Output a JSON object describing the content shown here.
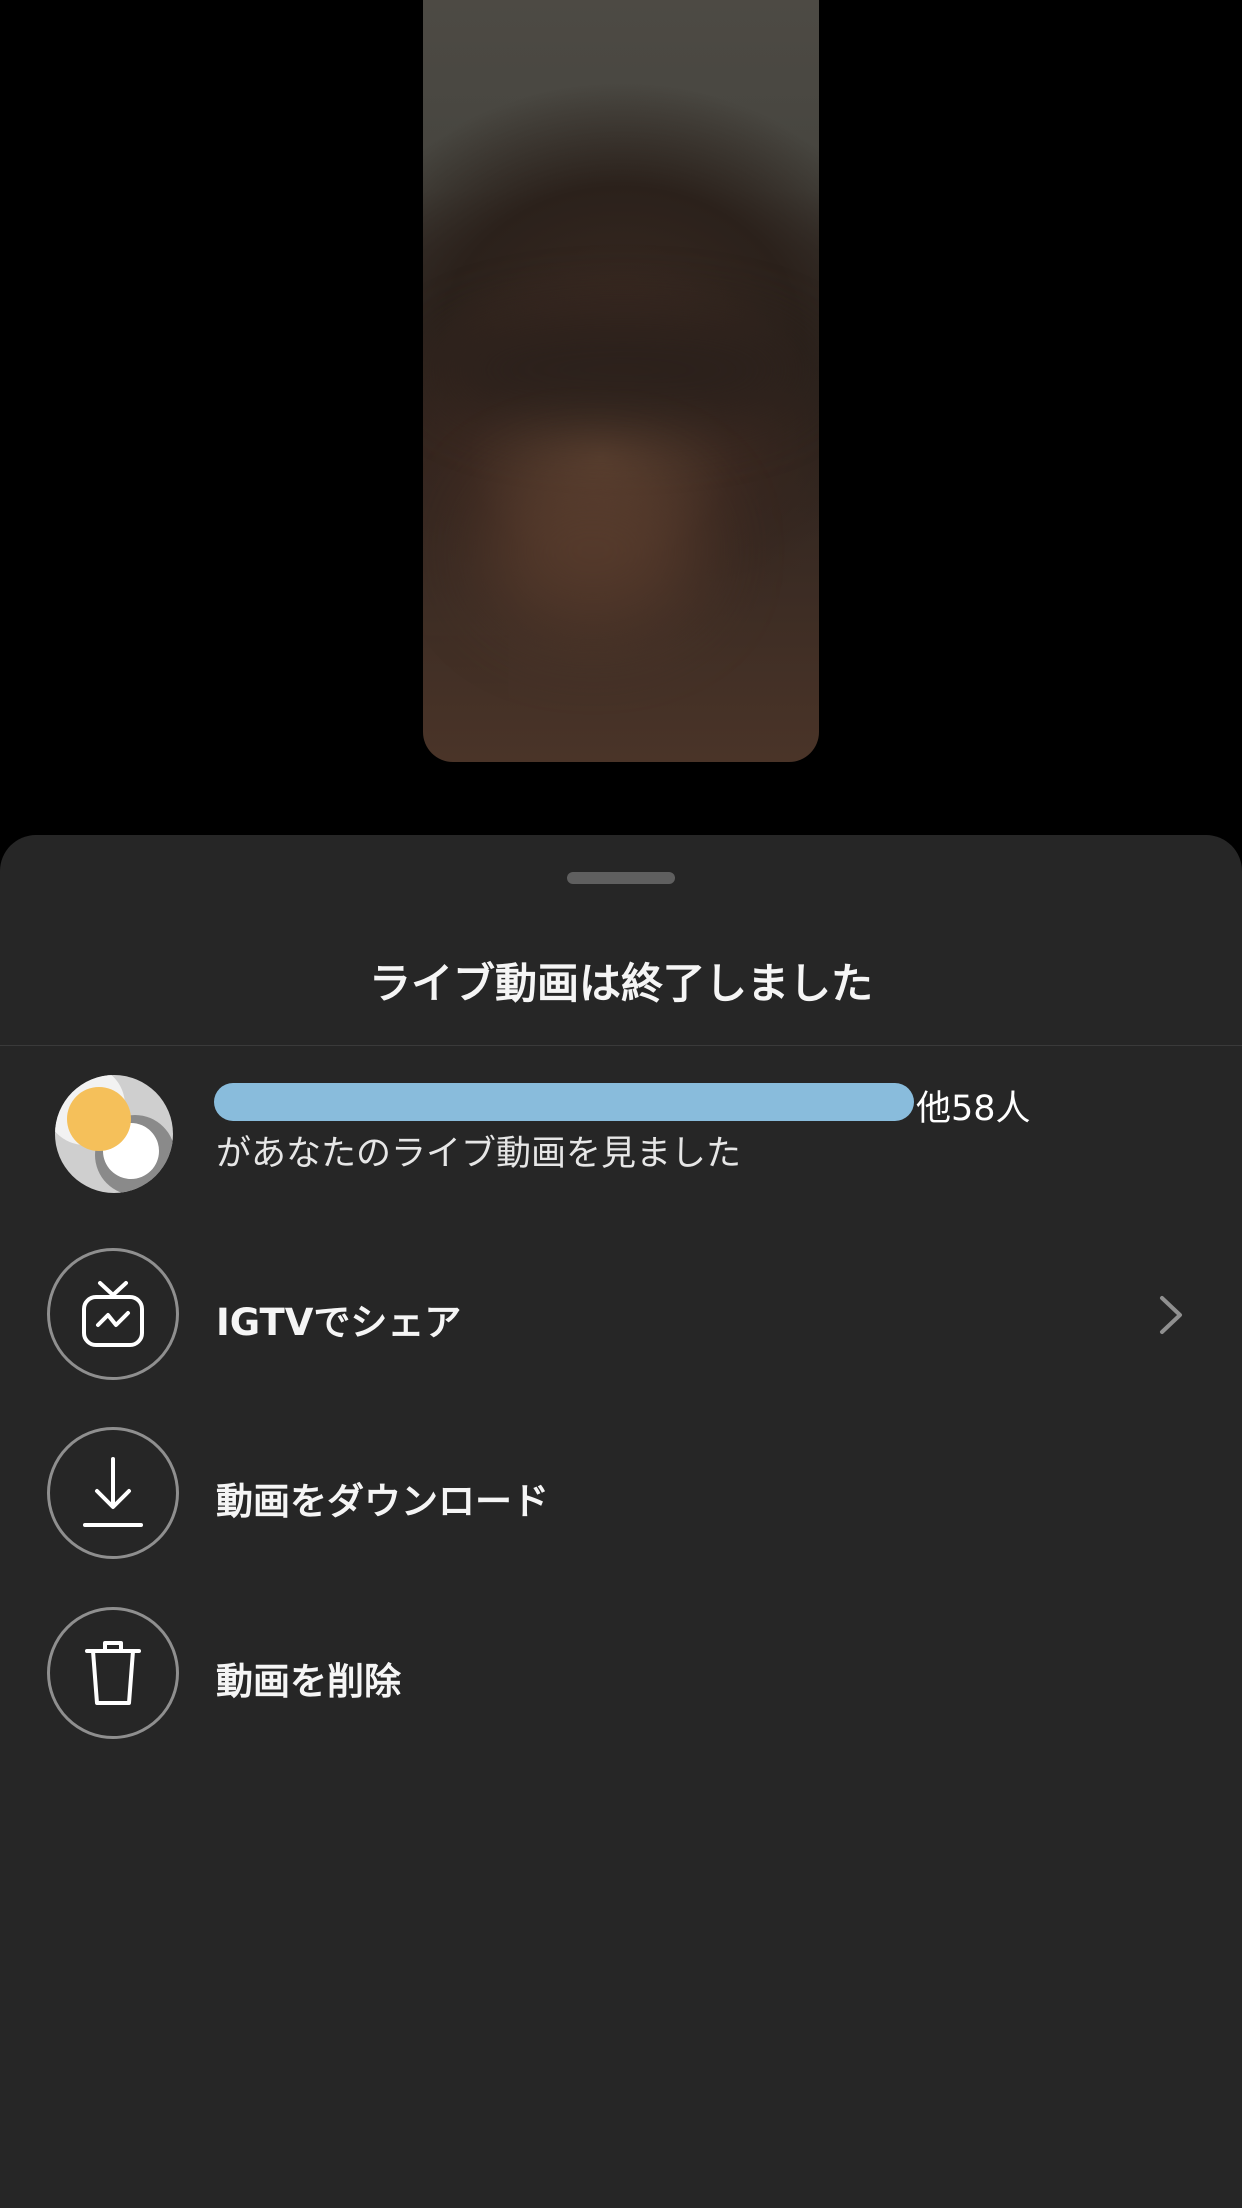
{
  "sheet": {
    "title": "ライブ動画は終了しました"
  },
  "viewers": {
    "name_suffix": "他58人",
    "subtitle": "があなたのライブ動画を見ました"
  },
  "actions": [
    {
      "label": "IGTVでシェア",
      "icon": "igtv-icon",
      "has_chevron": true
    },
    {
      "label": "動画をダウンロード",
      "icon": "download-icon"
    },
    {
      "label": "動画を削除",
      "icon": "trash-icon"
    }
  ],
  "colors": {
    "sheet_bg": "#262626",
    "redaction": "#89bcdc",
    "avatar_dot": "#f5c05a"
  }
}
